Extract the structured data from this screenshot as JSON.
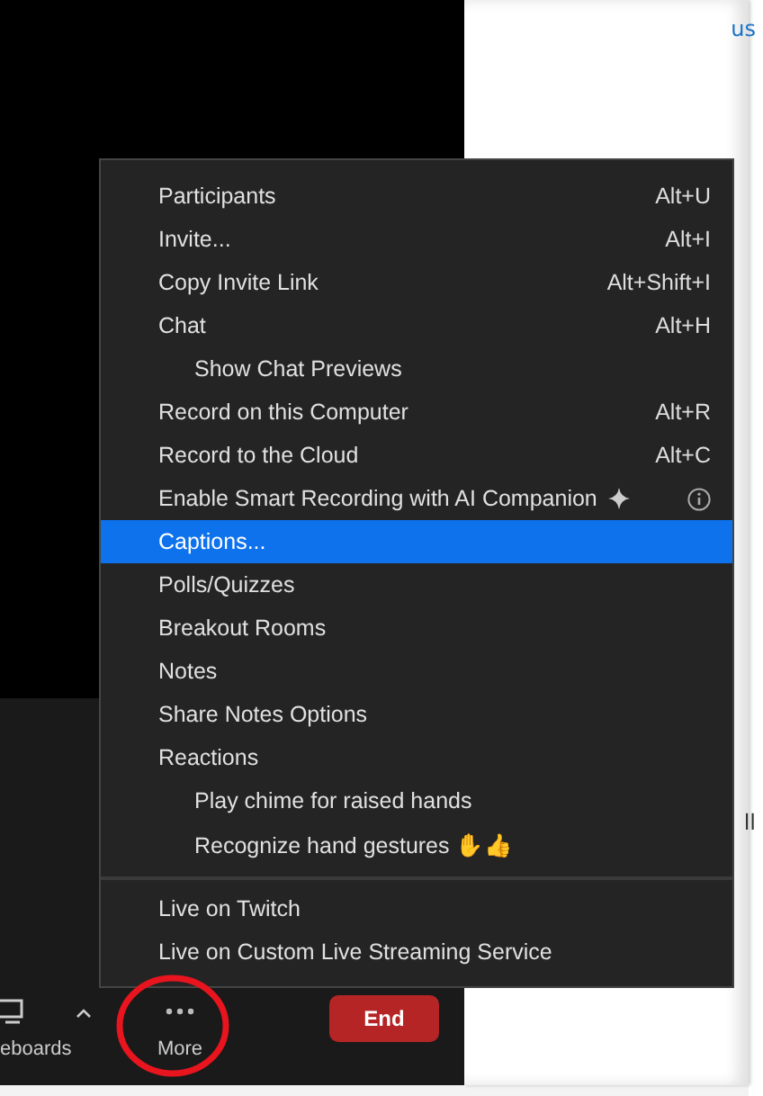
{
  "side_panel": {
    "fragments": [
      "us",
      "ll"
    ]
  },
  "toolbar": {
    "items": [
      {
        "kind": "screen",
        "label": "eboards"
      },
      {
        "kind": "caret"
      },
      {
        "kind": "more",
        "label": "More"
      }
    ],
    "end_button": "End"
  },
  "menu": {
    "sections": [
      [
        {
          "label": "Participants",
          "shortcut": "Alt+U",
          "selected": false
        },
        {
          "label": "Invite...",
          "shortcut": "Alt+I",
          "selected": false
        },
        {
          "label": "Copy Invite Link",
          "shortcut": "Alt+Shift+I",
          "selected": false
        },
        {
          "label": "Chat",
          "shortcut": "Alt+H",
          "selected": false,
          "children": [
            {
              "label": "Show Chat Previews",
              "selected": false
            }
          ]
        },
        {
          "label": "Record on this Computer",
          "shortcut": "Alt+R",
          "selected": false
        },
        {
          "label": "Record to the Cloud",
          "shortcut": "Alt+C",
          "selected": false
        },
        {
          "label": "Enable Smart Recording with AI Companion",
          "kind": "ai",
          "selected": false
        },
        {
          "label": "Captions...",
          "selected": true
        },
        {
          "label": "Polls/Quizzes",
          "selected": false
        },
        {
          "label": "Breakout Rooms",
          "selected": false
        },
        {
          "label": "Notes",
          "selected": false
        },
        {
          "label": "Share Notes Options",
          "selected": false
        },
        {
          "label": "Reactions",
          "selected": false,
          "children": [
            {
              "label": "Play chime for raised hands",
              "selected": false
            },
            {
              "label": "Recognize hand gestures ✋👍",
              "selected": false
            }
          ]
        }
      ],
      [
        {
          "label": "Live on Twitch",
          "selected": false
        },
        {
          "label": "Live on Custom Live Streaming Service",
          "selected": false
        }
      ]
    ]
  },
  "annotation": {
    "kind": "circle"
  }
}
